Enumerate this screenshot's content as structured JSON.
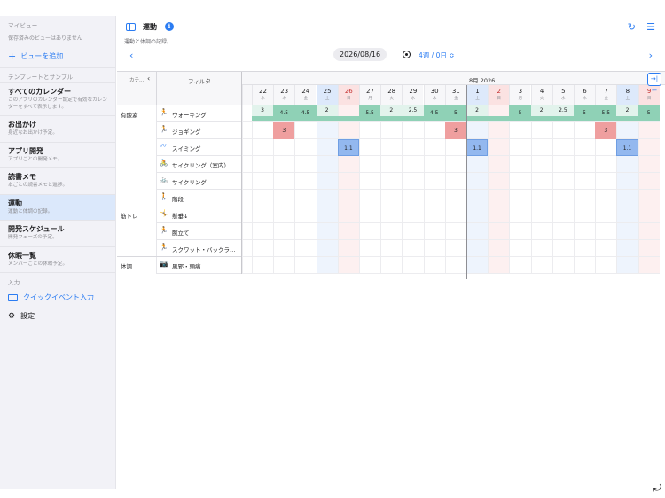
{
  "sidebar": {
    "my_views_title": "マイビュー",
    "no_views": "保存済みのビューはありません",
    "add_view": "ビューを追加",
    "templates_title": "テンプレートとサンプル",
    "items": [
      {
        "title": "すべてのカレンダー",
        "subtitle": "このアプリのカレンダー設定で有効なカレンダーをすべて表示します。",
        "active": false
      },
      {
        "title": "お出かけ",
        "subtitle": "身近なお出かけ予定。",
        "active": false
      },
      {
        "title": "アプリ開発",
        "subtitle": "アプリごとの開発メモ。",
        "active": false
      },
      {
        "title": "読書メモ",
        "subtitle": "本ごとの読書メモと進捗。",
        "active": false
      },
      {
        "title": "運動",
        "subtitle": "運動と体調の記録。",
        "active": true
      },
      {
        "title": "開発スケジュール",
        "subtitle": "開発フェーズの予定。",
        "active": false
      },
      {
        "title": "休暇一覧",
        "subtitle": "メンバーごとの休暇予定。",
        "active": false
      }
    ],
    "input_title": "入力",
    "quick_event": "クイックイベント入力",
    "settings": "設定"
  },
  "header": {
    "title": "運動",
    "subtitle": "運動と体調の記録。",
    "date": "2026/08/16",
    "range": "4週 / 0日 ≎"
  },
  "grid": {
    "category_header": "カテ…",
    "filter_header": "フィルタ",
    "month_label": "8月 2026",
    "days": [
      {
        "n": "",
        "w": "",
        "t": ""
      },
      {
        "n": "22",
        "w": "水",
        "t": ""
      },
      {
        "n": "23",
        "w": "木",
        "t": ""
      },
      {
        "n": "24",
        "w": "金",
        "t": ""
      },
      {
        "n": "25",
        "w": "土",
        "t": "sat"
      },
      {
        "n": "26",
        "w": "日",
        "t": "sun"
      },
      {
        "n": "27",
        "w": "月",
        "t": ""
      },
      {
        "n": "28",
        "w": "火",
        "t": ""
      },
      {
        "n": "29",
        "w": "水",
        "t": ""
      },
      {
        "n": "30",
        "w": "木",
        "t": ""
      },
      {
        "n": "31",
        "w": "金",
        "t": ""
      },
      {
        "n": "1",
        "w": "土",
        "t": "sat"
      },
      {
        "n": "2",
        "w": "日",
        "t": "sun"
      },
      {
        "n": "3",
        "w": "月",
        "t": ""
      },
      {
        "n": "4",
        "w": "火",
        "t": ""
      },
      {
        "n": "5",
        "w": "水",
        "t": ""
      },
      {
        "n": "6",
        "w": "木",
        "t": ""
      },
      {
        "n": "7",
        "w": "金",
        "t": ""
      },
      {
        "n": "8",
        "w": "土",
        "t": "sat"
      },
      {
        "n": "9",
        "w": "日",
        "t": "sun"
      }
    ],
    "rows": [
      {
        "cat": "有酸素",
        "icon": "🏃",
        "icon_name": "walking-icon",
        "color": "#34a06a",
        "name": "ウォーキング"
      },
      {
        "cat": "",
        "icon": "🏃",
        "icon_name": "running-icon",
        "color": "#e0453a",
        "name": "ジョギング"
      },
      {
        "cat": "",
        "icon": "〰",
        "icon_name": "swimming-icon",
        "color": "#2b7cf2",
        "name": "スイミング"
      },
      {
        "cat": "",
        "icon": "🚴",
        "icon_name": "indoor-cycling-icon",
        "color": "#f09a2a",
        "name": "サイクリング（室内）"
      },
      {
        "cat": "",
        "icon": "🚲",
        "icon_name": "cycling-icon",
        "color": "#8a57d6",
        "name": "サイクリング"
      },
      {
        "cat": "",
        "icon": "🚶",
        "icon_name": "stairs-icon",
        "color": "#34a06a",
        "name": "階段"
      },
      {
        "cat": "筋トレ",
        "icon": "🤸",
        "icon_name": "situp-icon",
        "color": "#2b7cf2",
        "name": "懸垂↓"
      },
      {
        "cat": "",
        "icon": "🏃",
        "icon_name": "pushup-icon",
        "color": "#e0453a",
        "name": "腕立て"
      },
      {
        "cat": "",
        "icon": "🏃",
        "icon_name": "squat-icon",
        "color": "#f09a2a",
        "name": "スクワット・バックラ…"
      },
      {
        "cat": "体調",
        "icon": "📷",
        "icon_name": "health-icon",
        "color": "#8a57d6",
        "name": "風邪・頭痛"
      }
    ],
    "marks": [
      {
        "row": 0,
        "col": 1,
        "v": "3",
        "k": "lgreen"
      },
      {
        "row": 0,
        "col": 2,
        "v": "4.5",
        "k": "green"
      },
      {
        "row": 0,
        "col": 3,
        "v": "4.5",
        "k": "green"
      },
      {
        "row": 0,
        "col": 4,
        "v": "2",
        "k": "lgreen"
      },
      {
        "row": 0,
        "col": 6,
        "v": "5.5",
        "k": "green"
      },
      {
        "row": 0,
        "col": 7,
        "v": "2",
        "k": "lgreen"
      },
      {
        "row": 0,
        "col": 8,
        "v": "2.5",
        "k": "lgreen"
      },
      {
        "row": 0,
        "col": 9,
        "v": "4.5",
        "k": "green"
      },
      {
        "row": 0,
        "col": 10,
        "v": "5",
        "k": "green"
      },
      {
        "row": 0,
        "col": 11,
        "v": "2",
        "k": "lgreen"
      },
      {
        "row": 0,
        "col": 13,
        "v": "5",
        "k": "green"
      },
      {
        "row": 0,
        "col": 14,
        "v": "2",
        "k": "lgreen"
      },
      {
        "row": 0,
        "col": 15,
        "v": "2.5",
        "k": "lgreen"
      },
      {
        "row": 0,
        "col": 16,
        "v": "5",
        "k": "green"
      },
      {
        "row": 0,
        "col": 17,
        "v": "5.5",
        "k": "green"
      },
      {
        "row": 0,
        "col": 18,
        "v": "2",
        "k": "lgreen"
      },
      {
        "row": 0,
        "col": 19,
        "v": "5",
        "k": "green"
      },
      {
        "row": 1,
        "col": 2,
        "v": "3",
        "k": "red"
      },
      {
        "row": 1,
        "col": 10,
        "v": "3",
        "k": "red"
      },
      {
        "row": 1,
        "col": 17,
        "v": "3",
        "k": "red"
      },
      {
        "row": 2,
        "col": 5,
        "v": "1.1",
        "k": "blue"
      },
      {
        "row": 2,
        "col": 11,
        "v": "1.1",
        "k": "blue"
      },
      {
        "row": 2,
        "col": 18,
        "v": "1.1",
        "k": "blue"
      }
    ]
  },
  "colors": {
    "accent": "#2b7cf2",
    "walk_green": "#8fd1b6",
    "run_red": "#ef9f9f",
    "swim_blue": "#93b8ef"
  }
}
